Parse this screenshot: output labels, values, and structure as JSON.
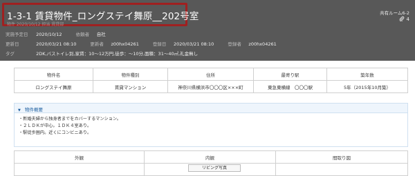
{
  "header": {
    "title": "1-3-1 賃貸物件_ロングステイ舞原__202号室",
    "subtitle": "物件    2020/10/12    担当    賃貸部",
    "shared_room": "共有ルーム6-2",
    "clip_icon": "paperclip-icon",
    "clip_count": "4",
    "meta": {
      "row1": [
        {
          "label": "実施予定日",
          "value": "2020/10/12"
        },
        {
          "label": "依頼者",
          "value": "自社"
        }
      ],
      "row2": [
        {
          "label": "更新日",
          "value": "2020/03/21 08:10"
        },
        {
          "label": "更新者",
          "value": "z00hx04261"
        },
        {
          "label": "登録日",
          "value": "2020/03/21 08:10"
        },
        {
          "label": "登録者",
          "value": "z00hx04261"
        }
      ],
      "row3": [
        {
          "label": "タグ",
          "value": "2DK,バストイレ別,家賃：10～12万円,徒歩：～10分,面積：31～40㎡,礼金無し"
        }
      ]
    }
  },
  "property_table": {
    "columns": [
      "物件名",
      "物件種別",
      "住所",
      "最寄り駅",
      "築年数"
    ],
    "row": [
      "ロングステイ舞原",
      "賃貸マンション",
      "神奈川県横浜市〇〇〇区×××町",
      "東急東横線　〇〇〇駅",
      "5年（2015年10月築）"
    ]
  },
  "overview": {
    "toggle_icon": "triangle-down-icon",
    "heading": "物件概要",
    "lines": [
      "・新婚夫婦から独身者までをカバーするマンション。",
      "・２ＬＤＫが中心。１ＤＫ４室あり。",
      "・駅徒歩圏内。近くにコンビニあり。"
    ]
  },
  "photo_table": {
    "columns": [
      "外観",
      "内観",
      "間取り図"
    ],
    "living_photo_label": "リビング写真"
  }
}
